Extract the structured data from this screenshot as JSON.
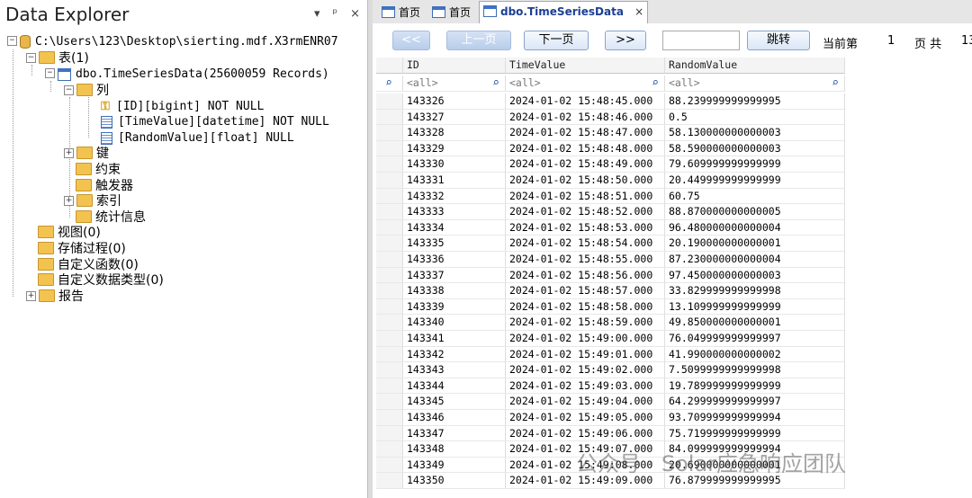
{
  "explorer": {
    "title": "Data Explorer",
    "tools": [
      "▾",
      "ᵖ",
      "×"
    ],
    "db_path": "C:\\Users\\123\\Desktop\\sierting.mdf.X3rmENR07",
    "tables_node": "表(1)",
    "table_node": "dbo.TimeSeriesData(25600059 Records)",
    "columns_node": "列",
    "columns": [
      "[ID][bigint] NOT NULL",
      "[TimeValue][datetime] NOT NULL",
      "[RandomValue][float] NULL"
    ],
    "keys_node": "键",
    "constraints_node": "约束",
    "triggers_node": "触发器",
    "indexes_node": "索引",
    "stats_node": "统计信息",
    "views_node": "视图(0)",
    "procs_node": "存储过程(0)",
    "funcs_node": "自定义函数(0)",
    "types_node": "自定义数据类型(0)",
    "reports_node": "报告"
  },
  "tabs": [
    "首页",
    "首页",
    "dbo.TimeSeriesData"
  ],
  "tab_close": "×",
  "toolbar": {
    "first": "<<",
    "prev": "上一页",
    "next": "下一页",
    "last": ">>",
    "jump": "跳转",
    "current_page_label": "当前第",
    "current_page": "1",
    "page_total_label": "页 共",
    "total_trunc": "13"
  },
  "grid": {
    "columns": [
      "ID",
      "TimeValue",
      "RandomValue"
    ],
    "filters": [
      "<all>",
      "<all>",
      "<all>"
    ],
    "rows": [
      [
        "143326",
        "2024-01-02 15:48:45.000",
        "88.239999999999995"
      ],
      [
        "143327",
        "2024-01-02 15:48:46.000",
        "0.5"
      ],
      [
        "143328",
        "2024-01-02 15:48:47.000",
        "58.130000000000003"
      ],
      [
        "143329",
        "2024-01-02 15:48:48.000",
        "58.590000000000003"
      ],
      [
        "143330",
        "2024-01-02 15:48:49.000",
        "79.609999999999999"
      ],
      [
        "143331",
        "2024-01-02 15:48:50.000",
        "20.449999999999999"
      ],
      [
        "143332",
        "2024-01-02 15:48:51.000",
        "60.75"
      ],
      [
        "143333",
        "2024-01-02 15:48:52.000",
        "88.870000000000005"
      ],
      [
        "143334",
        "2024-01-02 15:48:53.000",
        "96.480000000000004"
      ],
      [
        "143335",
        "2024-01-02 15:48:54.000",
        "20.190000000000001"
      ],
      [
        "143336",
        "2024-01-02 15:48:55.000",
        "87.230000000000004"
      ],
      [
        "143337",
        "2024-01-02 15:48:56.000",
        "97.450000000000003"
      ],
      [
        "143338",
        "2024-01-02 15:48:57.000",
        "33.829999999999998"
      ],
      [
        "143339",
        "2024-01-02 15:48:58.000",
        "13.109999999999999"
      ],
      [
        "143340",
        "2024-01-02 15:48:59.000",
        "49.850000000000001"
      ],
      [
        "143341",
        "2024-01-02 15:49:00.000",
        "76.049999999999997"
      ],
      [
        "143342",
        "2024-01-02 15:49:01.000",
        "41.990000000000002"
      ],
      [
        "143343",
        "2024-01-02 15:49:02.000",
        "7.5099999999999998"
      ],
      [
        "143344",
        "2024-01-02 15:49:03.000",
        "19.789999999999999"
      ],
      [
        "143345",
        "2024-01-02 15:49:04.000",
        "64.299999999999997"
      ],
      [
        "143346",
        "2024-01-02 15:49:05.000",
        "93.709999999999994"
      ],
      [
        "143347",
        "2024-01-02 15:49:06.000",
        "75.719999999999999"
      ],
      [
        "143348",
        "2024-01-02 15:49:07.000",
        "84.099999999999994"
      ],
      [
        "143349",
        "2024-01-02 15:49:08.000",
        "20.690000000000001"
      ],
      [
        "143350",
        "2024-01-02 15:49:09.000",
        "76.879999999999995"
      ]
    ]
  },
  "watermark": "公众号 · Solar应急响应团队"
}
